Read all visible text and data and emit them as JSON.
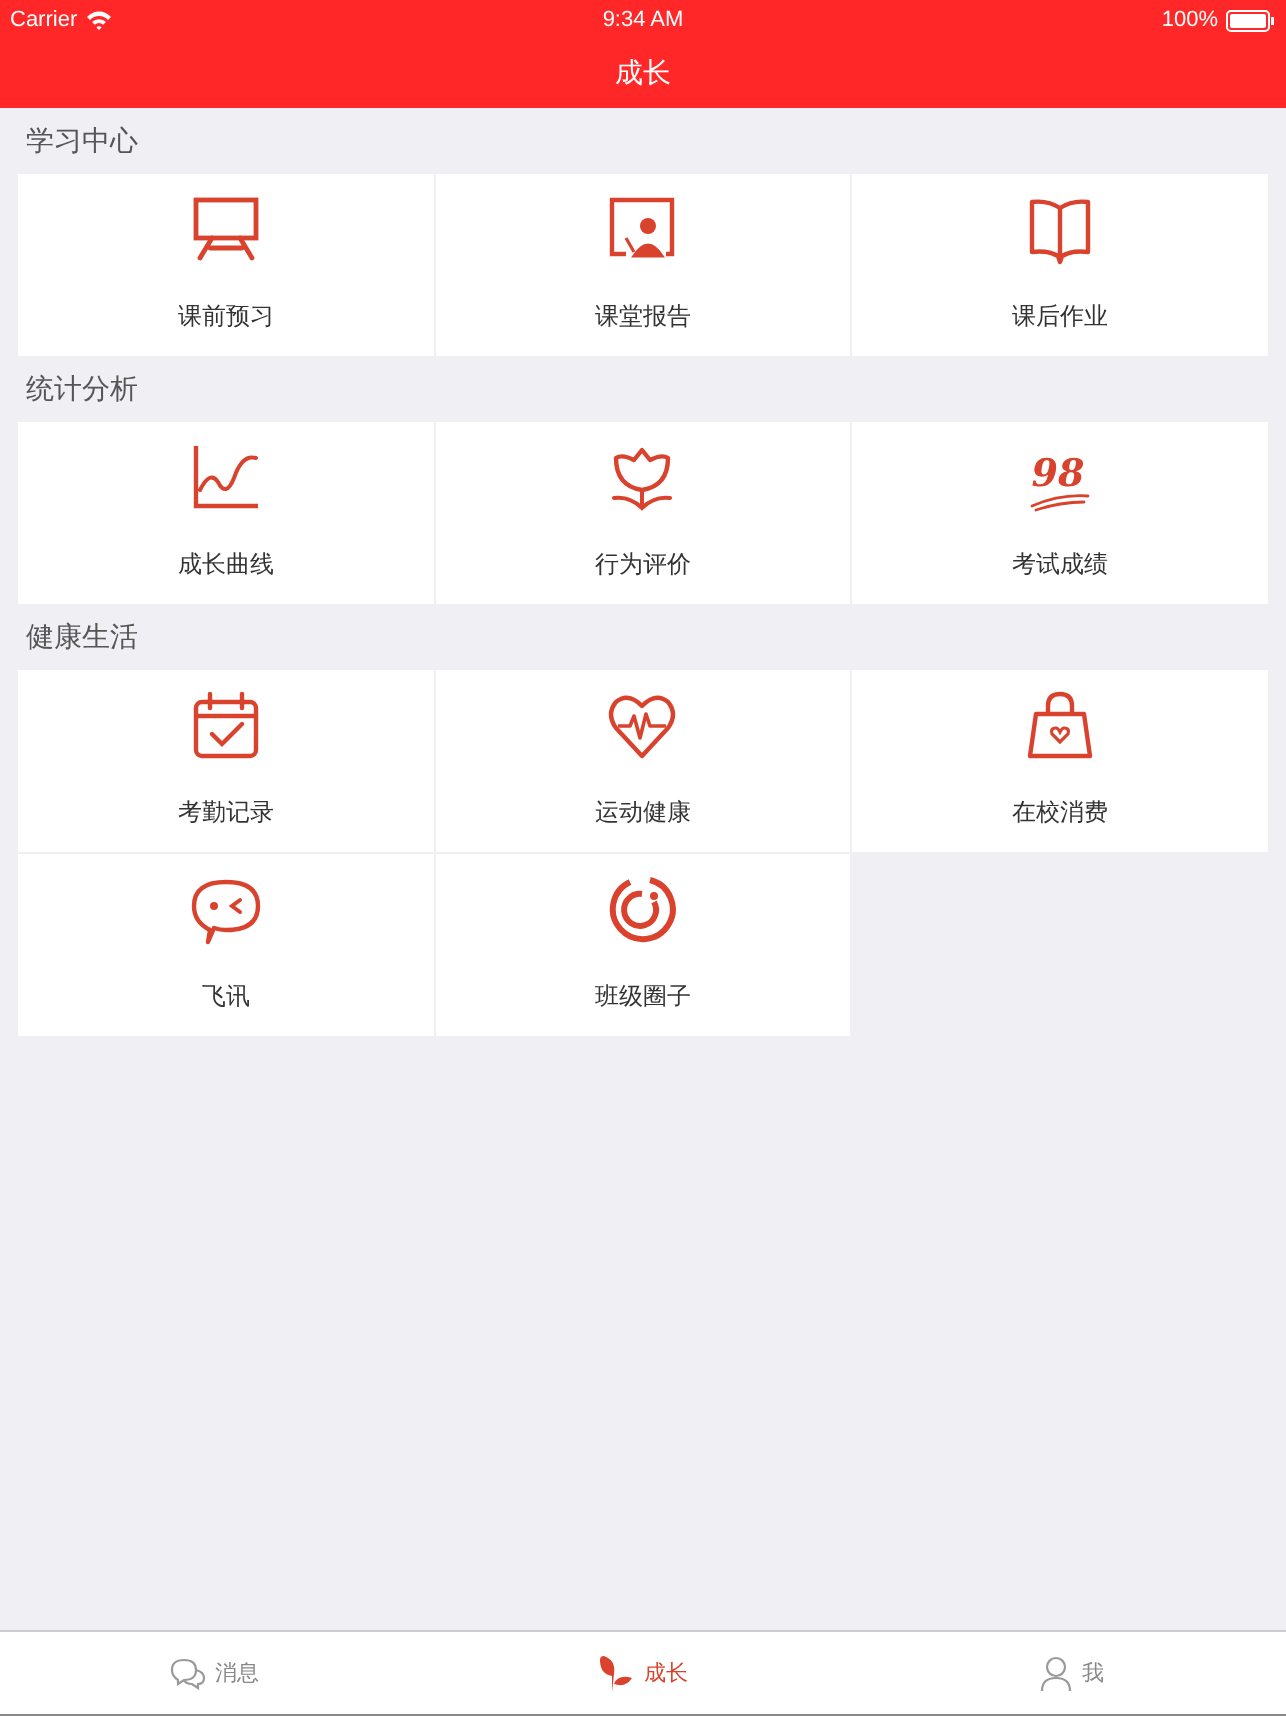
{
  "status_bar": {
    "carrier": "Carrier",
    "time": "9:34 AM",
    "battery": "100%"
  },
  "nav": {
    "title": "成长"
  },
  "sections": [
    {
      "title": "学习中心",
      "items": [
        {
          "label": "课前预习",
          "kind": "easel"
        },
        {
          "label": "课堂报告",
          "kind": "screen"
        },
        {
          "label": "课后作业",
          "kind": "book"
        }
      ]
    },
    {
      "title": "统计分析",
      "items": [
        {
          "label": "成长曲线",
          "kind": "chart"
        },
        {
          "label": "行为评价",
          "kind": "flower"
        },
        {
          "label": "考试成绩",
          "kind": "score",
          "icon_text": "98"
        }
      ]
    },
    {
      "title": "健康生活",
      "items": [
        {
          "label": "考勤记录",
          "kind": "calendar"
        },
        {
          "label": "运动健康",
          "kind": "heart"
        },
        {
          "label": "在校消费",
          "kind": "bag"
        },
        {
          "label": "飞讯",
          "kind": "chat"
        },
        {
          "label": "班级圈子",
          "kind": "circle"
        }
      ]
    }
  ],
  "tab_bar": [
    {
      "label": "消息",
      "kind": "chat",
      "selected": false
    },
    {
      "label": "成长",
      "kind": "sprout",
      "selected": true
    },
    {
      "label": "我",
      "kind": "person",
      "selected": false
    }
  ]
}
